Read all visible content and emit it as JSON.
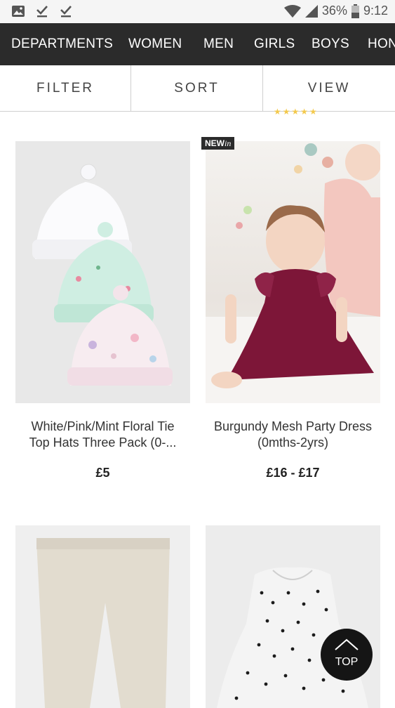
{
  "status_bar": {
    "battery": "36%",
    "time": "9:12"
  },
  "nav": {
    "items": [
      "DEPARTMENTS",
      "WOMEN",
      "MEN",
      "GIRLS",
      "BOYS",
      "HON"
    ]
  },
  "toolbar": {
    "filter": "FILTER",
    "sort": "SORT",
    "view": "VIEW"
  },
  "badge": {
    "new": "NEW",
    "in": "in"
  },
  "products": [
    {
      "title": "White/Pink/Mint Floral Tie Top Hats Three Pack (0-...",
      "price": "£5"
    },
    {
      "title": "Burgundy Mesh Party Dress (0mths-2yrs)",
      "price": "£16 - £17"
    }
  ],
  "top_button": {
    "label": "TOP"
  },
  "colors": {
    "nav_bg": "#2b2b2b",
    "star": "#f3c94d",
    "dress": "#7d1638"
  }
}
